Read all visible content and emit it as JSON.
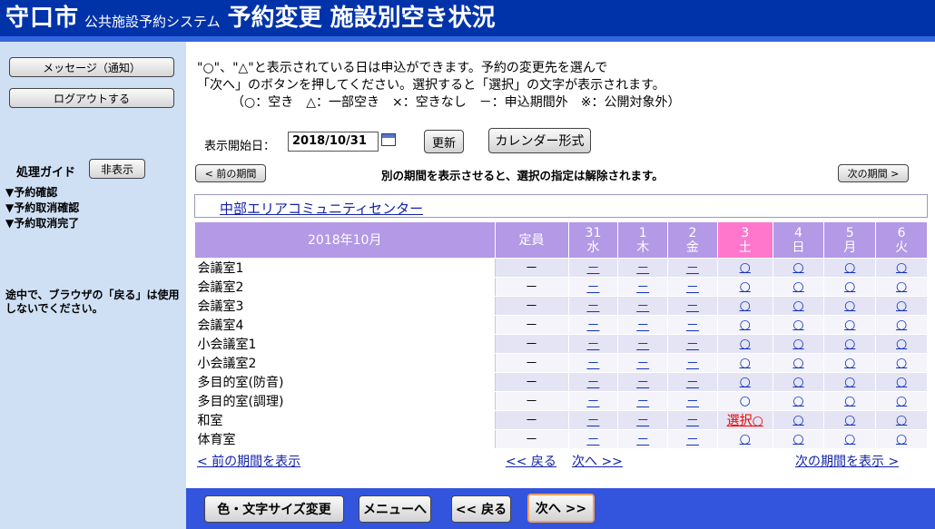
{
  "header": {
    "city": "守口市",
    "system": "公共施設予約システム",
    "title": "予約変更 施設別空き状況"
  },
  "sidebar": {
    "message_btn": "メッセージ（通知）",
    "logout_btn": "ログアウトする",
    "guide_label": "処理ガイド",
    "hide_btn": "非表示",
    "steps": [
      "▼予約確認",
      "▼予約取消確認",
      "▼予約取消完了"
    ],
    "warning": "途中で、ブラウザの「戻る」は使用しないでください。"
  },
  "intro": {
    "line1": "\"○\"、\"△\"と表示されている日は申込ができます。予約の変更先を選んで",
    "line2": "「次へ」のボタンを押してください。選択すると「選択」の文字が表示されます。",
    "line3": "（○：空き　△：一部空き　×：空きなし　－：申込期間外　※：公開対象外）"
  },
  "date": {
    "label": "表示開始日：",
    "value": "2018/10/31",
    "update_btn": "更新",
    "calendar_btn": "カレンダー形式"
  },
  "period": {
    "prev_btn": "< 前の期間",
    "note": "別の期間を表示させると、選択の指定は解除されます。",
    "next_btn": "次の期間 >"
  },
  "facility": "中部エリアコミュニティセンター",
  "table": {
    "month": "2018年10月",
    "cap_header": "定員",
    "days": [
      {
        "d": "31",
        "w": "水",
        "sat": false
      },
      {
        "d": "1",
        "w": "木",
        "sat": false
      },
      {
        "d": "2",
        "w": "金",
        "sat": false
      },
      {
        "d": "3",
        "w": "土",
        "sat": true
      },
      {
        "d": "4",
        "w": "日",
        "sat": false
      },
      {
        "d": "5",
        "w": "月",
        "sat": false
      },
      {
        "d": "6",
        "w": "火",
        "sat": false
      }
    ],
    "rows": [
      {
        "name": "会議室1",
        "cap": "－",
        "cells": [
          "－",
          "－",
          "－",
          "○",
          "○",
          "○",
          "○"
        ]
      },
      {
        "name": "会議室2",
        "cap": "－",
        "cells": [
          "－",
          "－",
          "－",
          "○",
          "○",
          "○",
          "○"
        ]
      },
      {
        "name": "会議室3",
        "cap": "－",
        "cells": [
          "－",
          "－",
          "－",
          "○",
          "○",
          "○",
          "○"
        ]
      },
      {
        "name": "会議室4",
        "cap": "－",
        "cells": [
          "－",
          "－",
          "－",
          "○",
          "○",
          "○",
          "○"
        ]
      },
      {
        "name": "小会議室1",
        "cap": "－",
        "cells": [
          "－",
          "－",
          "－",
          "○",
          "○",
          "○",
          "○"
        ]
      },
      {
        "name": "小会議室2",
        "cap": "－",
        "cells": [
          "－",
          "－",
          "－",
          "○",
          "○",
          "○",
          "○"
        ]
      },
      {
        "name": "多目的室(防音)",
        "cap": "－",
        "cells": [
          "－",
          "－",
          "－",
          "○",
          "○",
          "○",
          "○"
        ]
      },
      {
        "name": "多目的室(調理)",
        "cap": "－",
        "cells": [
          "－",
          "－",
          "－",
          "○*",
          "○",
          "○",
          "○"
        ]
      },
      {
        "name": "和室",
        "cap": "－",
        "cells": [
          "－",
          "－",
          "－",
          "選択○",
          "○",
          "○",
          "○"
        ]
      },
      {
        "name": "体育室",
        "cap": "－",
        "cells": [
          "－",
          "－",
          "－",
          "○",
          "○",
          "○",
          "○"
        ]
      }
    ]
  },
  "links": {
    "prev_period": "< 前の期間を表示",
    "back": "<< 戻る",
    "next": "次へ >>",
    "next_period": "次の期間を表示 >"
  },
  "footer": {
    "size_btn": "色・文字サイズ変更",
    "menu_btn": "メニューへ",
    "back_btn": "<< 戻る",
    "next_btn": "次へ >>"
  }
}
